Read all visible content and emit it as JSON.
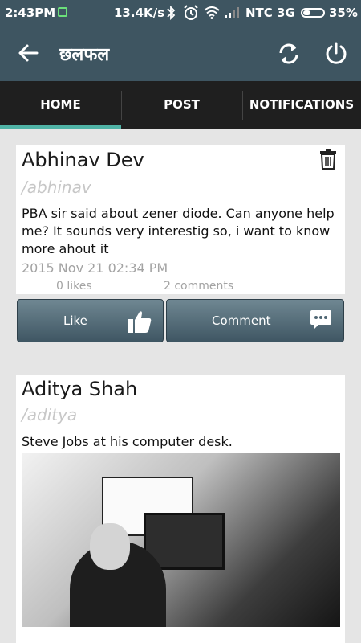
{
  "status": {
    "time": "2:43PM",
    "speed": "13.4K/s",
    "network": "NTC 3G",
    "battery": "35%"
  },
  "appbar": {
    "title": "छलफल"
  },
  "tabs": [
    "HOME",
    "POST",
    "NOTIFICATIONS"
  ],
  "active_tab": 0,
  "posts": [
    {
      "author": "Abhinav Dev",
      "handle": "/abhinav",
      "text": "PBA sir said about zener diode. Can anyone help me? It sounds very interestig so, i want to know more ahout it",
      "date": "2015 Nov 21 02:34 PM",
      "likes": "0 likes",
      "comments": "2 comments"
    },
    {
      "author": "Aditya Shah",
      "handle": "/aditya",
      "text": "Steve Jobs at his computer desk."
    }
  ],
  "actions": {
    "like": "Like",
    "comment": "Comment"
  },
  "icons": {
    "back": "arrow-back-icon",
    "refresh": "refresh-icon",
    "power": "power-icon",
    "trash": "trash-icon",
    "like": "thumbs-up-icon",
    "comment": "chat-bubble-icon"
  },
  "colors": {
    "appbar": "#3e5561",
    "tabbar": "#1f1f1f",
    "indicator": "#4fb3a6",
    "background": "#e5e5e5"
  }
}
